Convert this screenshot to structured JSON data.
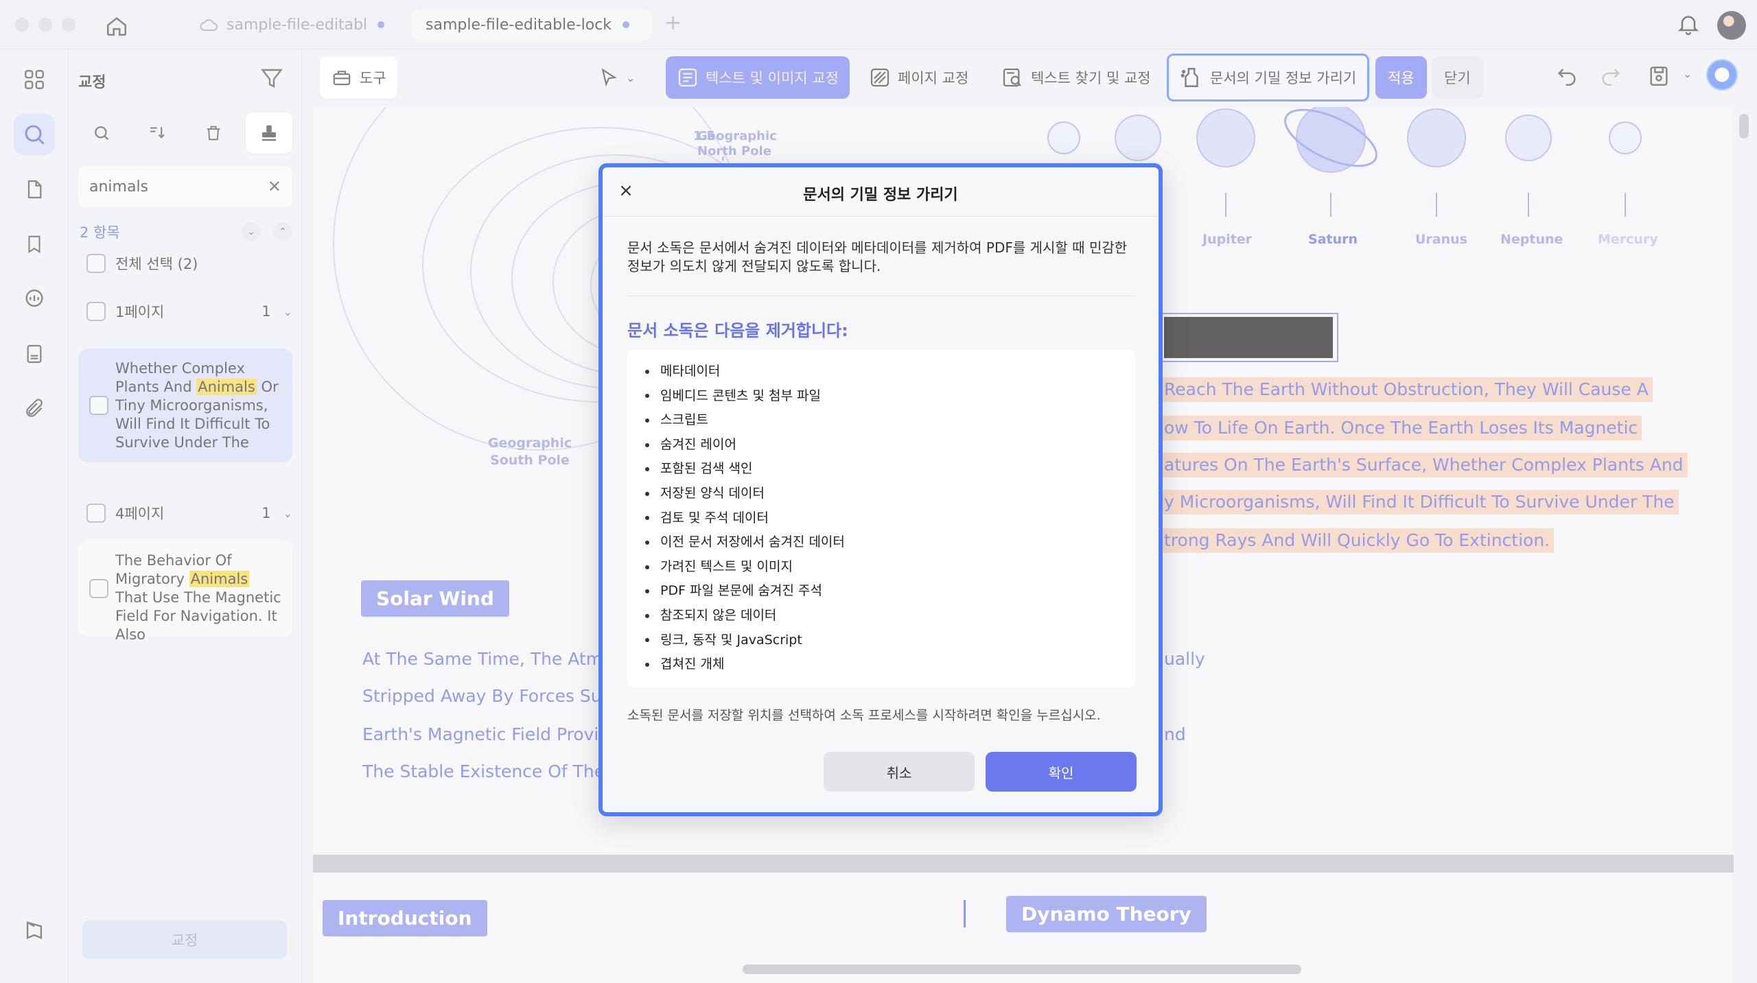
{
  "window": {
    "tabs": [
      {
        "label": "sample-file-editable"
      },
      {
        "label": "sample-file-editable-lock"
      }
    ],
    "new_tab": "+"
  },
  "sidebar": {
    "title": "교정",
    "search_value": "animals",
    "result_count": "2 항목",
    "select_all": "전체 선택  (2)",
    "groups": [
      {
        "page_label": "1페이지",
        "count": "1",
        "snippet": {
          "before": "Whether Complex Plants And ",
          "match": "Animals",
          "after": " Or Tiny Microorganisms, Will Find It Difficult To Survive Under The"
        }
      },
      {
        "page_label": "4페이지",
        "count": "1",
        "snippet": {
          "before": "The Behavior Of Migratory ",
          "match": "Animals",
          "after": " That Use The Magnetic Field For Navigation. It Also"
        }
      }
    ],
    "bottom_button": "교정"
  },
  "toolbar": {
    "tool": "도구",
    "text_image_redact": "텍스트 및 이미지 교정",
    "page_redact": "페이지 교정",
    "find_redact": "텍스트 찾기 및 교정",
    "sanitize": "문서의 기밀 정보 가리기",
    "apply": "적용",
    "close": "닫기"
  },
  "document": {
    "diagram_labels": {
      "north_pole": "Geographic North Pole",
      "south_pole": "Geographic South Pole",
      "angle": "1.5"
    },
    "planets": [
      "Jupiter",
      "Saturn",
      "Uranus",
      "Neptune",
      "Mercury"
    ],
    "highlighted_lines": [
      "Reach The Earth Without Obstruction, They Will Cause A",
      "ow To Life On Earth. Once The Earth Loses Its Magnetic",
      "atures On The Earth's Surface, Whether Complex Plants And",
      "y Microorganisms, Will Find It Difficult To Survive Under The",
      "trong Rays And Will Quickly Go To Extinction."
    ],
    "solar_wind_heading": "Solar Wind",
    "body_lines_left": [
      "At The Same Time, The Atmo",
      "Stripped Away By Forces Suc",
      "Earth's Magnetic Field Provide",
      "The Stable Existence Of The A"
    ],
    "body_lines_right": [
      "ually",
      "nd",
      "."
    ],
    "page2_headings": [
      "Introduction",
      "Dynamo Theory"
    ]
  },
  "dialog": {
    "close": "×",
    "title": "문서의 기밀 정보 가리기",
    "description": "문서 소독은 문서에서 숨겨진 데이터와 메타데이터를 제거하여 PDF를 게시할 때 민감한 정보가 의도치 않게 전달되지 않도록 합니다.",
    "subtitle": "문서 소독은 다음을 제거합니다:",
    "items": [
      "메타데이터",
      "임베디드 콘텐츠 및 첨부 파일",
      "스크립트",
      "숨겨진 레이어",
      "포함된 검색 색인",
      "저장된 양식 데이터",
      "검토 및 주석 데이터",
      "이전 문서 저장에서 숨겨진 데이터",
      "가려진 텍스트 및 이미지",
      "PDF 파일 본문에 숨겨진 주석",
      "참조되지 않은 데이터",
      "링크, 동작 및 JavaScript",
      "겹쳐진 개체"
    ],
    "note": "소독된 문서를 저장할 위치를 선택하여 소독 프로세스를 시작하려면 확인을 누르십시오.",
    "cancel": "취소",
    "confirm": "확인"
  },
  "colors": {
    "accent": "#6b78ee",
    "focus_border": "#4f7df7",
    "highlight": "#f4d233",
    "redaction_mark": "#f0a878"
  }
}
